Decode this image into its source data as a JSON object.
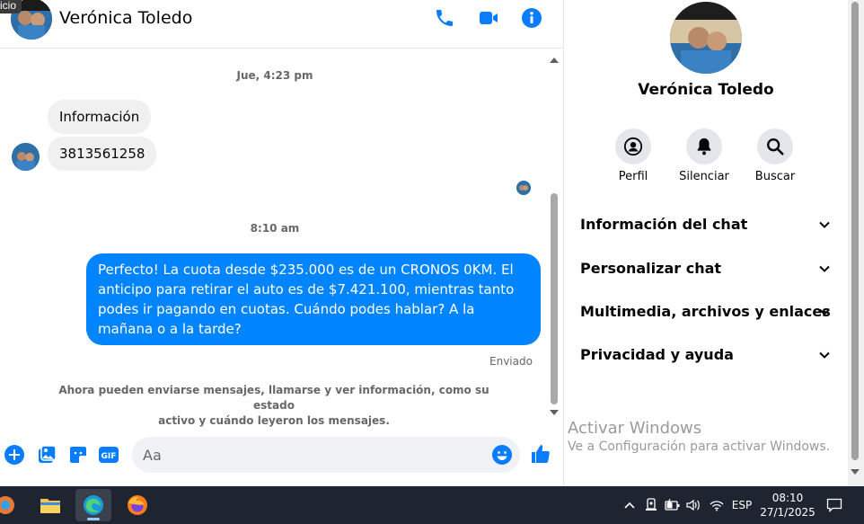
{
  "window": {
    "inicio_tag": "icio"
  },
  "header": {
    "contact_name": "Verónica Toledo"
  },
  "messages": {
    "timestamp_1": "Jue, 4:23 pm",
    "incoming_1": "Información",
    "incoming_2": "3813561258",
    "timestamp_2": "8:10 am",
    "outgoing_1": "Perfecto! La cuota desde $235.000 es de un CRONOS 0KM. El anticipo para retirar el auto es de $7.421.100, mientras tanto podes ir pagando en cuotas. Cuándo podes hablar? A la mañana o a la tarde?",
    "outgoing_status": "Enviado",
    "notice_line1": "Ahora pueden enviarse mensajes, llamarse y ver información, como su estado",
    "notice_line2": "activo y cuándo leyeron los mensajes."
  },
  "composer": {
    "placeholder": "Aa"
  },
  "panel": {
    "contact_name": "Verónica Toledo",
    "actions": [
      {
        "label": "Perfil",
        "icon": "profile-icon"
      },
      {
        "label": "Silenciar",
        "icon": "bell-icon"
      },
      {
        "label": "Buscar",
        "icon": "search-icon"
      }
    ],
    "sections": [
      {
        "label": "Información del chat"
      },
      {
        "label": "Personalizar chat"
      },
      {
        "label": "Multimedia, archivos y enlaces"
      },
      {
        "label": "Privacidad y ayuda"
      }
    ]
  },
  "watermark": {
    "title": "Activar Windows",
    "subtitle": "Ve a Configuración para activar Windows."
  },
  "taskbar": {
    "language": "ESP",
    "time": "08:10",
    "date": "27/1/2025"
  },
  "colors": {
    "accent": "#0084ff",
    "bubble_in": "#f0f0f0",
    "taskbar": "#1f2530"
  }
}
